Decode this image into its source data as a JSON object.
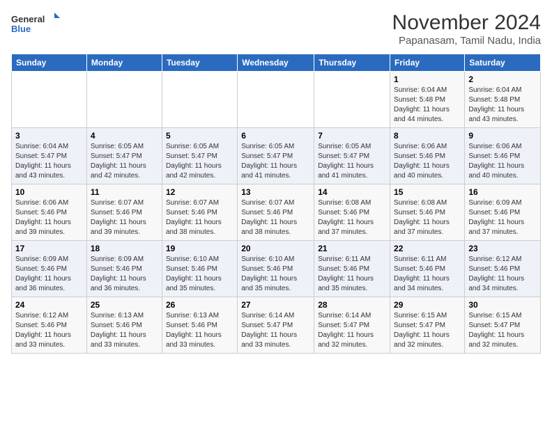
{
  "logo": {
    "line1": "General",
    "line2": "Blue"
  },
  "title": "November 2024",
  "subtitle": "Papanasam, Tamil Nadu, India",
  "headers": [
    "Sunday",
    "Monday",
    "Tuesday",
    "Wednesday",
    "Thursday",
    "Friday",
    "Saturday"
  ],
  "weeks": [
    [
      {
        "day": "",
        "content": ""
      },
      {
        "day": "",
        "content": ""
      },
      {
        "day": "",
        "content": ""
      },
      {
        "day": "",
        "content": ""
      },
      {
        "day": "",
        "content": ""
      },
      {
        "day": "1",
        "content": "Sunrise: 6:04 AM\nSunset: 5:48 PM\nDaylight: 11 hours and 44 minutes."
      },
      {
        "day": "2",
        "content": "Sunrise: 6:04 AM\nSunset: 5:48 PM\nDaylight: 11 hours and 43 minutes."
      }
    ],
    [
      {
        "day": "3",
        "content": "Sunrise: 6:04 AM\nSunset: 5:47 PM\nDaylight: 11 hours and 43 minutes."
      },
      {
        "day": "4",
        "content": "Sunrise: 6:05 AM\nSunset: 5:47 PM\nDaylight: 11 hours and 42 minutes."
      },
      {
        "day": "5",
        "content": "Sunrise: 6:05 AM\nSunset: 5:47 PM\nDaylight: 11 hours and 42 minutes."
      },
      {
        "day": "6",
        "content": "Sunrise: 6:05 AM\nSunset: 5:47 PM\nDaylight: 11 hours and 41 minutes."
      },
      {
        "day": "7",
        "content": "Sunrise: 6:05 AM\nSunset: 5:47 PM\nDaylight: 11 hours and 41 minutes."
      },
      {
        "day": "8",
        "content": "Sunrise: 6:06 AM\nSunset: 5:46 PM\nDaylight: 11 hours and 40 minutes."
      },
      {
        "day": "9",
        "content": "Sunrise: 6:06 AM\nSunset: 5:46 PM\nDaylight: 11 hours and 40 minutes."
      }
    ],
    [
      {
        "day": "10",
        "content": "Sunrise: 6:06 AM\nSunset: 5:46 PM\nDaylight: 11 hours and 39 minutes."
      },
      {
        "day": "11",
        "content": "Sunrise: 6:07 AM\nSunset: 5:46 PM\nDaylight: 11 hours and 39 minutes."
      },
      {
        "day": "12",
        "content": "Sunrise: 6:07 AM\nSunset: 5:46 PM\nDaylight: 11 hours and 38 minutes."
      },
      {
        "day": "13",
        "content": "Sunrise: 6:07 AM\nSunset: 5:46 PM\nDaylight: 11 hours and 38 minutes."
      },
      {
        "day": "14",
        "content": "Sunrise: 6:08 AM\nSunset: 5:46 PM\nDaylight: 11 hours and 37 minutes."
      },
      {
        "day": "15",
        "content": "Sunrise: 6:08 AM\nSunset: 5:46 PM\nDaylight: 11 hours and 37 minutes."
      },
      {
        "day": "16",
        "content": "Sunrise: 6:09 AM\nSunset: 5:46 PM\nDaylight: 11 hours and 37 minutes."
      }
    ],
    [
      {
        "day": "17",
        "content": "Sunrise: 6:09 AM\nSunset: 5:46 PM\nDaylight: 11 hours and 36 minutes."
      },
      {
        "day": "18",
        "content": "Sunrise: 6:09 AM\nSunset: 5:46 PM\nDaylight: 11 hours and 36 minutes."
      },
      {
        "day": "19",
        "content": "Sunrise: 6:10 AM\nSunset: 5:46 PM\nDaylight: 11 hours and 35 minutes."
      },
      {
        "day": "20",
        "content": "Sunrise: 6:10 AM\nSunset: 5:46 PM\nDaylight: 11 hours and 35 minutes."
      },
      {
        "day": "21",
        "content": "Sunrise: 6:11 AM\nSunset: 5:46 PM\nDaylight: 11 hours and 35 minutes."
      },
      {
        "day": "22",
        "content": "Sunrise: 6:11 AM\nSunset: 5:46 PM\nDaylight: 11 hours and 34 minutes."
      },
      {
        "day": "23",
        "content": "Sunrise: 6:12 AM\nSunset: 5:46 PM\nDaylight: 11 hours and 34 minutes."
      }
    ],
    [
      {
        "day": "24",
        "content": "Sunrise: 6:12 AM\nSunset: 5:46 PM\nDaylight: 11 hours and 33 minutes."
      },
      {
        "day": "25",
        "content": "Sunrise: 6:13 AM\nSunset: 5:46 PM\nDaylight: 11 hours and 33 minutes."
      },
      {
        "day": "26",
        "content": "Sunrise: 6:13 AM\nSunset: 5:46 PM\nDaylight: 11 hours and 33 minutes."
      },
      {
        "day": "27",
        "content": "Sunrise: 6:14 AM\nSunset: 5:47 PM\nDaylight: 11 hours and 33 minutes."
      },
      {
        "day": "28",
        "content": "Sunrise: 6:14 AM\nSunset: 5:47 PM\nDaylight: 11 hours and 32 minutes."
      },
      {
        "day": "29",
        "content": "Sunrise: 6:15 AM\nSunset: 5:47 PM\nDaylight: 11 hours and 32 minutes."
      },
      {
        "day": "30",
        "content": "Sunrise: 6:15 AM\nSunset: 5:47 PM\nDaylight: 11 hours and 32 minutes."
      }
    ]
  ]
}
